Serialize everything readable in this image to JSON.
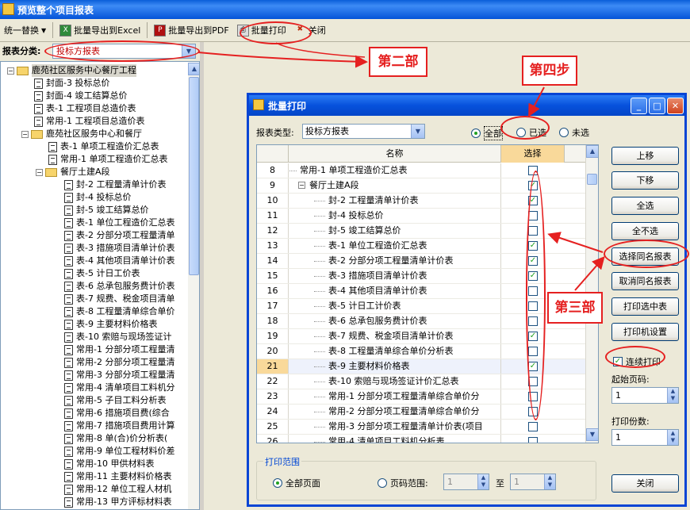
{
  "window": {
    "title": "预览整个项目报表"
  },
  "toolbar": {
    "replace": "统一替换",
    "export_excel": "批量导出到Excel",
    "export_pdf": "批量导出到PDF",
    "batch_print": "批量打印",
    "close": "关闭"
  },
  "category": {
    "label": "报表分类:",
    "value": "投标方报表"
  },
  "tree": [
    {
      "text": "鹿苑社区服务中心餐厅工程",
      "kind": "folder"
    },
    {
      "text": "封面-3 投标总价",
      "kind": "doc"
    },
    {
      "text": "封面-4 竣工结算总价",
      "kind": "doc"
    },
    {
      "text": "表-1 工程项目总造价表",
      "kind": "doc"
    },
    {
      "text": "常用-1 工程项目总造价表",
      "kind": "doc"
    },
    {
      "text": "鹿苑社区服务中心和餐厅",
      "kind": "folder"
    },
    {
      "text": "表-1 单项工程造价汇总表",
      "kind": "doc"
    },
    {
      "text": "常用-1 单项工程造价汇总表",
      "kind": "doc"
    },
    {
      "text": "餐厅土建A段",
      "kind": "folder"
    },
    {
      "text": "封-2 工程量清单计价表",
      "kind": "doc"
    },
    {
      "text": "封-4 投标总价",
      "kind": "doc"
    },
    {
      "text": "封-5 竣工结算总价",
      "kind": "doc"
    },
    {
      "text": "表-1 单位工程造价汇总表",
      "kind": "doc"
    },
    {
      "text": "表-2 分部分项工程量清单",
      "kind": "doc"
    },
    {
      "text": "表-3 措施项目清单计价表",
      "kind": "doc"
    },
    {
      "text": "表-4 其他项目清单计价表",
      "kind": "doc"
    },
    {
      "text": "表-5 计日工价表",
      "kind": "doc"
    },
    {
      "text": "表-6 总承包服务费计价表",
      "kind": "doc"
    },
    {
      "text": "表-7 规费、税金项目清单",
      "kind": "doc"
    },
    {
      "text": "表-8 工程量清单综合单价",
      "kind": "doc"
    },
    {
      "text": "表-9 主要材料价格表",
      "kind": "doc"
    },
    {
      "text": "表-10 索赔与现场签证计",
      "kind": "doc"
    },
    {
      "text": "常用-1 分部分项工程量清",
      "kind": "doc"
    },
    {
      "text": "常用-2 分部分项工程量清",
      "kind": "doc"
    },
    {
      "text": "常用-3 分部分项工程量清",
      "kind": "doc"
    },
    {
      "text": "常用-4 清单项目工料机分",
      "kind": "doc"
    },
    {
      "text": "常用-5 子目工料分析表",
      "kind": "doc"
    },
    {
      "text": "常用-6 措施项目费(综合",
      "kind": "doc"
    },
    {
      "text": "常用-7 措施项目费用计算",
      "kind": "doc"
    },
    {
      "text": "常用-8 单(合)价分析表(",
      "kind": "doc"
    },
    {
      "text": "常用-9 单位工程材料价差",
      "kind": "doc"
    },
    {
      "text": "常用-10 甲供材料表",
      "kind": "doc"
    },
    {
      "text": "常用-11 主要材料价格表",
      "kind": "doc"
    },
    {
      "text": "常用-12 单位工程人材机",
      "kind": "doc"
    },
    {
      "text": "常用-13 甲方评标材料表",
      "kind": "doc"
    }
  ],
  "dialog": {
    "title": "批量打印",
    "type_label": "报表类型:",
    "type_value": "投标方报表",
    "filter_all": "全部",
    "filter_selected": "已选",
    "filter_unselected": "未选",
    "col_name": "名称",
    "col_select": "选择",
    "rows": [
      {
        "num": "8",
        "name": "常用-1 单项工程造价汇总表",
        "level": 1,
        "checked": false
      },
      {
        "num": "9",
        "name": "餐厅土建A段",
        "level": 1,
        "folder": true,
        "checked": true
      },
      {
        "num": "10",
        "name": "封-2 工程量清单计价表",
        "level": 2,
        "checked": true
      },
      {
        "num": "11",
        "name": "封-4 投标总价",
        "level": 2,
        "checked": false
      },
      {
        "num": "12",
        "name": "封-5 竣工结算总价",
        "level": 2,
        "checked": false
      },
      {
        "num": "13",
        "name": "表-1 单位工程造价汇总表",
        "level": 2,
        "checked": true
      },
      {
        "num": "14",
        "name": "表-2 分部分项工程量清单计价表",
        "level": 2,
        "checked": true
      },
      {
        "num": "15",
        "name": "表-3 措施项目清单计价表",
        "level": 2,
        "checked": true
      },
      {
        "num": "16",
        "name": "表-4 其他项目清单计价表",
        "level": 2,
        "checked": false
      },
      {
        "num": "17",
        "name": "表-5 计日工计价表",
        "level": 2,
        "checked": false
      },
      {
        "num": "18",
        "name": "表-6 总承包服务费计价表",
        "level": 2,
        "checked": false
      },
      {
        "num": "19",
        "name": "表-7 规费、税金项目清单计价表",
        "level": 2,
        "checked": true
      },
      {
        "num": "20",
        "name": "表-8 工程量清单综合单价分析表",
        "level": 2,
        "checked": false
      },
      {
        "num": "21",
        "name": "表-9 主要材料价格表",
        "level": 2,
        "checked": true,
        "highlight": true
      },
      {
        "num": "22",
        "name": "表-10 索赔与现场签证计价汇总表",
        "level": 2,
        "checked": false
      },
      {
        "num": "23",
        "name": "常用-1 分部分项工程量清单综合单价分",
        "level": 2,
        "checked": false
      },
      {
        "num": "24",
        "name": "常用-2 分部分项工程量清单综合单价分",
        "level": 2,
        "checked": false
      },
      {
        "num": "25",
        "name": "常用-3 分部分项工程量清单计价表(项目",
        "level": 2,
        "checked": false
      },
      {
        "num": "26",
        "name": "常用-4 清单项目工料机分析表",
        "level": 2,
        "checked": false
      }
    ],
    "buttons": {
      "up": "上移",
      "down": "下移",
      "select_all": "全选",
      "select_none": "全不选",
      "select_same": "选择同名报表",
      "cancel_same": "取消同名报表",
      "print_selected": "打印选中表",
      "printer_setup": "打印机设置",
      "close": "关闭"
    },
    "continuous_print": "连续打印",
    "start_page_label": "起始页码:",
    "start_page": "1",
    "copies_label": "打印份数:",
    "copies": "1",
    "range_label": "打印范围",
    "range_all": "全部页面",
    "range_pages": "页码范围:",
    "range_from": "1",
    "range_to_label": "至",
    "range_to": "1"
  },
  "annotations": {
    "step2": "第二部",
    "step3": "第三部",
    "step4": "第四步"
  },
  "colors": {
    "annotation": "#e52020",
    "title_bar": "#0a5ed8",
    "check": "#21a121"
  }
}
